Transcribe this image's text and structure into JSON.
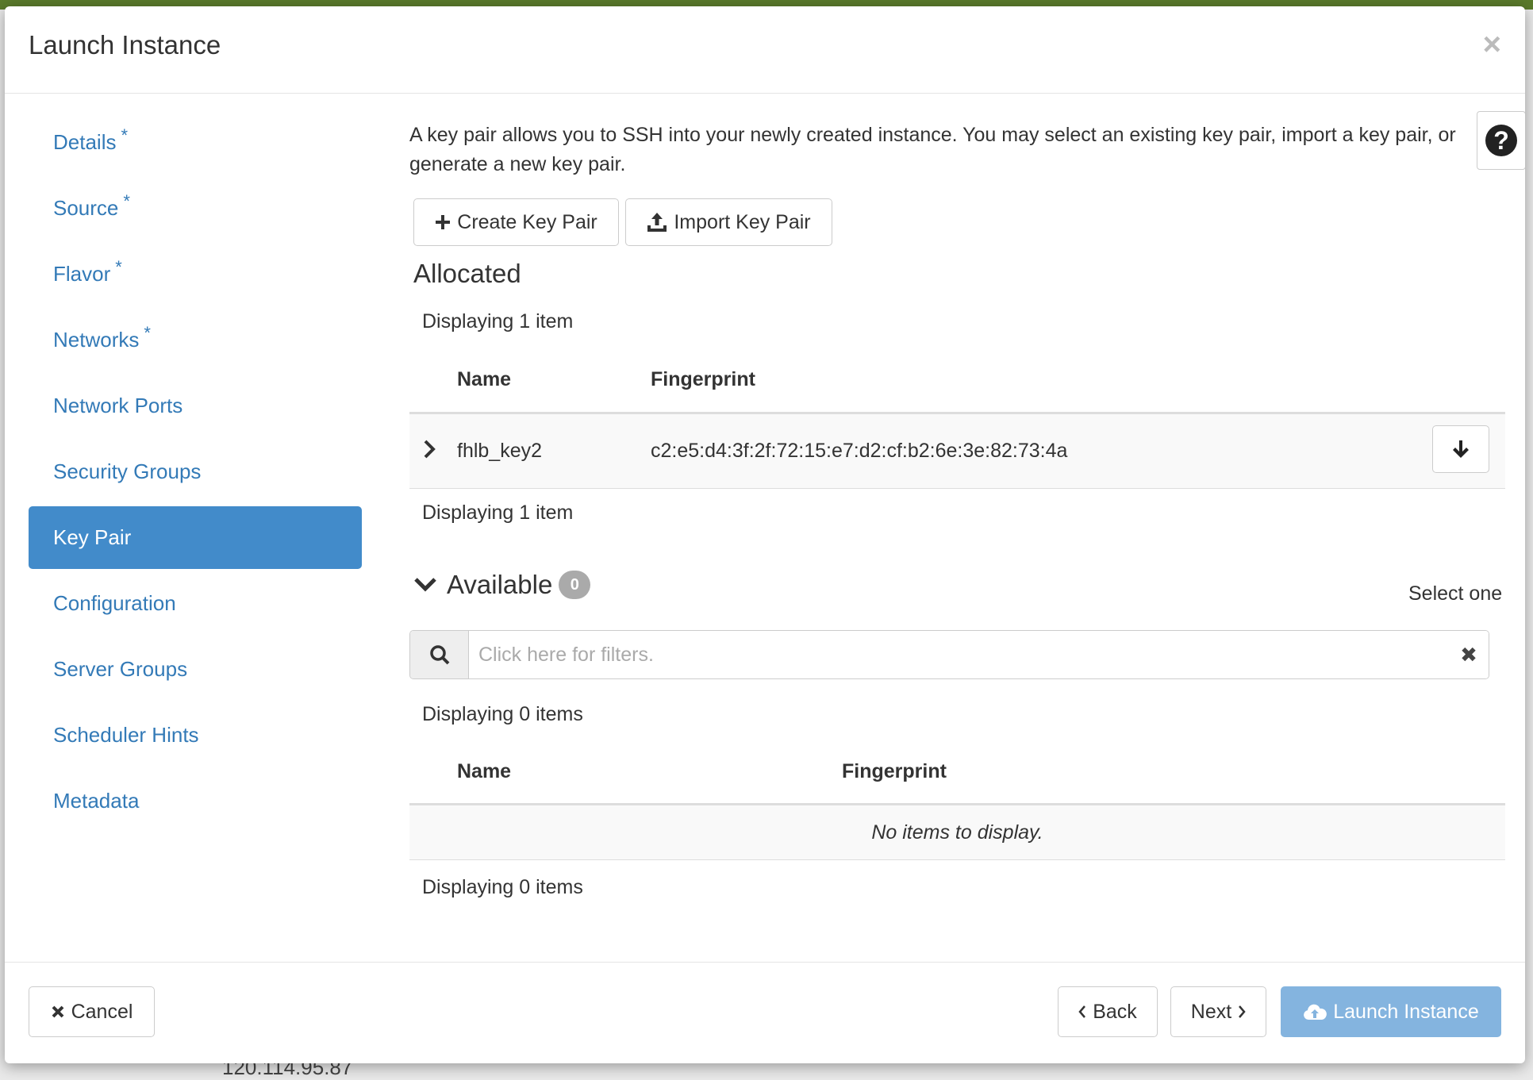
{
  "background_text": "120.114.95.87",
  "modal": {
    "title": "Launch Instance",
    "close_label": "×"
  },
  "sidebar": {
    "items": [
      {
        "label": "Details",
        "required": "*"
      },
      {
        "label": "Source",
        "required": "*"
      },
      {
        "label": "Flavor",
        "required": "*"
      },
      {
        "label": "Networks",
        "required": "*"
      },
      {
        "label": "Network Ports"
      },
      {
        "label": "Security Groups"
      },
      {
        "label": "Key Pair"
      },
      {
        "label": "Configuration"
      },
      {
        "label": "Server Groups"
      },
      {
        "label": "Scheduler Hints"
      },
      {
        "label": "Metadata"
      }
    ],
    "active_index": 6
  },
  "content": {
    "intro": "A key pair allows you to SSH into your newly created instance. You may select an existing key pair, import a key pair, or generate a new key pair.",
    "help_label": "?",
    "create_key_pair_label": "Create Key Pair",
    "import_key_pair_label": "Import Key Pair",
    "allocated": {
      "title": "Allocated",
      "displaying_top": "Displaying 1 item",
      "displaying_bottom": "Displaying 1 item",
      "columns": [
        "Name",
        "Fingerprint"
      ],
      "rows": [
        {
          "name": "fhlb_key2",
          "fingerprint": "c2:e5:d4:3f:2f:72:15:e7:d2:cf:b2:6e:3e:82:73:4a"
        }
      ]
    },
    "available": {
      "title": "Available",
      "count": "0",
      "select_hint": "Select one",
      "search_placeholder": "Click here for filters.",
      "clear_label": "✖",
      "displaying_top": "Displaying 0 items",
      "displaying_bottom": "Displaying 0 items",
      "columns": [
        "Name",
        "Fingerprint"
      ],
      "empty_message": "No items to display."
    }
  },
  "footer": {
    "cancel_label": "Cancel",
    "back_label": "Back",
    "next_label": "Next",
    "launch_label": "Launch Instance"
  },
  "colors": {
    "accent": "#428bca",
    "link": "#337ab7",
    "launch_button": "#84b4df",
    "top_bar": "#5a7a2b"
  }
}
